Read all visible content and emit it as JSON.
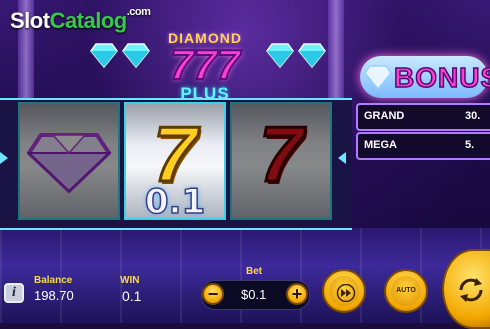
{
  "watermark": {
    "part1": "Slot",
    "part2": "Catalog",
    "suffix": ".com"
  },
  "logo": {
    "line1": "DIAMOND",
    "sevens": "777",
    "plus": "PLUS"
  },
  "reels": [
    {
      "symbol": "diamond-icon"
    },
    {
      "symbol": "7",
      "color": "#ffcf1f",
      "win_amount": "0.1"
    },
    {
      "symbol": "7",
      "color": "#e8141e"
    }
  ],
  "bonus": {
    "title": "BONUS",
    "jackpots": [
      {
        "label": "GRAND",
        "value": "30."
      },
      {
        "label": "MEGA",
        "value": "5."
      }
    ]
  },
  "hud": {
    "balance_label": "Balance",
    "balance_value": "198.70",
    "win_label": "WIN",
    "win_value": "0.1",
    "bet_label": "Bet",
    "bet_value": "$0.1",
    "minus": "−",
    "plus": "+",
    "auto_label": "AUTO",
    "info": "i"
  },
  "colors": {
    "accent_cyan": "#6ee6ff",
    "gold": "#ffd84a",
    "magenta": "#ff3fd1"
  }
}
